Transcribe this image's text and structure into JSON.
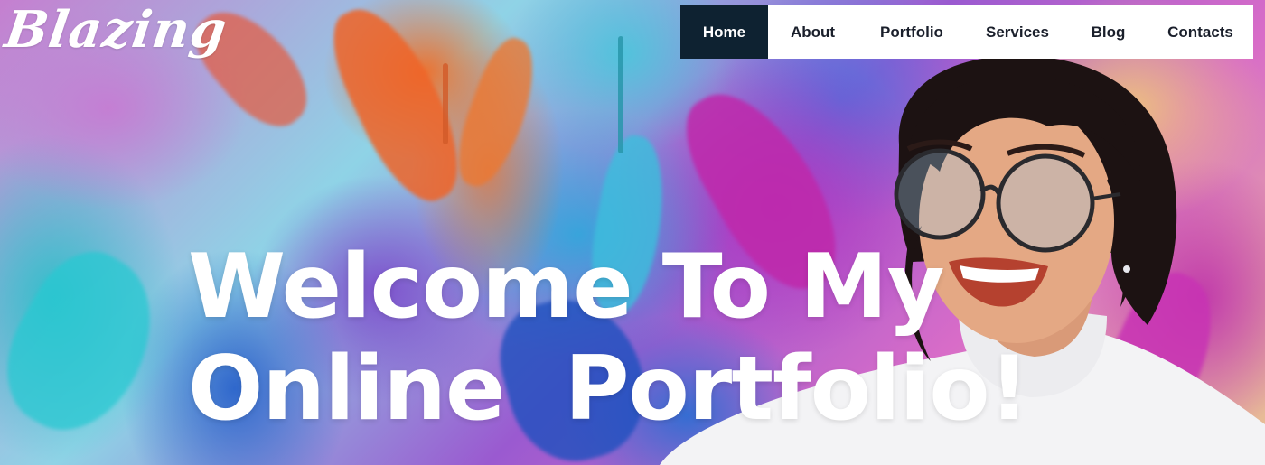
{
  "brand": {
    "logo_text": "Blazing"
  },
  "nav": {
    "items": [
      {
        "label": "Home",
        "active": true
      },
      {
        "label": "About",
        "active": false
      },
      {
        "label": "Portfolio",
        "active": false
      },
      {
        "label": "Services",
        "active": false
      },
      {
        "label": "Blog",
        "active": false
      },
      {
        "label": "Contacts",
        "active": false
      }
    ]
  },
  "hero": {
    "line1": "Welcome To My",
    "line2": "Online  Portfolio!"
  },
  "colors": {
    "nav_active_bg": "#0e2231",
    "nav_text": "#1a1f2b",
    "headline": "#ffffff"
  }
}
